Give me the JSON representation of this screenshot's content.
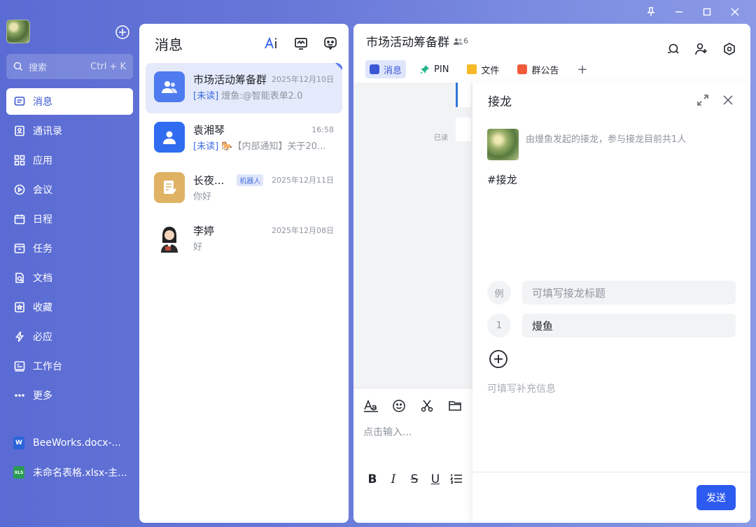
{
  "window": {
    "controls": [
      "pin",
      "minimize",
      "maximize",
      "close"
    ]
  },
  "sidebar": {
    "search": {
      "placeholder": "搜索",
      "shortcut": "Ctrl + K"
    },
    "items": [
      {
        "label": "消息",
        "icon": "message-icon",
        "active": true
      },
      {
        "label": "通讯录",
        "icon": "contacts-icon"
      },
      {
        "label": "应用",
        "icon": "apps-icon"
      },
      {
        "label": "会议",
        "icon": "meeting-icon"
      },
      {
        "label": "日程",
        "icon": "calendar-icon"
      },
      {
        "label": "任务",
        "icon": "task-icon"
      },
      {
        "label": "文档",
        "icon": "document-icon"
      },
      {
        "label": "收藏",
        "icon": "favorite-icon"
      },
      {
        "label": "必应",
        "icon": "bolt-icon"
      },
      {
        "label": "工作台",
        "icon": "workbench-icon"
      },
      {
        "label": "更多",
        "icon": "more-icon"
      }
    ],
    "recent_files": [
      {
        "label": "BeeWorks.docx-...",
        "type": "W"
      },
      {
        "label": "未命名表格.xlsx-主...",
        "type": "XLS"
      }
    ]
  },
  "list": {
    "title": "消息",
    "conversations": [
      {
        "name": "市场活动筹备群",
        "time": "2025年12月10日",
        "unread": "[未读]",
        "preview": "熳鱼:@智能表单2.0"
      },
      {
        "name": "袁湘琴",
        "time": "16:58",
        "unread": "[未读]",
        "preview": "🐎【内部通知】关于20..."
      },
      {
        "name": "长夜...",
        "badge": "机器人",
        "time": "2025年12月11日",
        "preview": "你好"
      },
      {
        "name": "李婷",
        "time": "2025年12月08日",
        "preview": "好"
      }
    ]
  },
  "chat": {
    "title": "市场活动筹备群",
    "member_count": "6",
    "tabs": [
      {
        "label": "消息",
        "active": true
      },
      {
        "label": "PIN"
      },
      {
        "label": "文件"
      },
      {
        "label": "群公告"
      },
      {
        "label": "+"
      }
    ],
    "read_status": "已读",
    "composer_placeholder": "点击输入..."
  },
  "jielong": {
    "title": "接龙",
    "description": "由熳鱼发起的接龙，参与接龙目前共1人",
    "tag": "#接龙",
    "example_label": "例",
    "title_placeholder": "可填写接龙标题",
    "entry_index": "1",
    "entry_value": "熳鱼",
    "extra_placeholder": "可填写补充信息",
    "send_label": "发送"
  }
}
